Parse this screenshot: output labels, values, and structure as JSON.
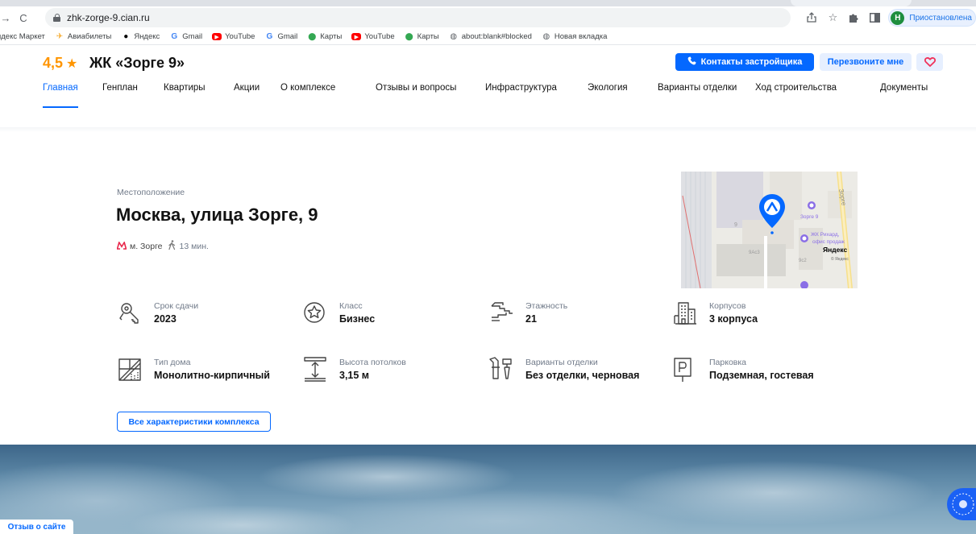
{
  "browser": {
    "url": "zhk-zorge-9.cian.ru",
    "profile_label": "Приостановлена",
    "profile_initial": "Н",
    "bookmarks": [
      {
        "label": "ндекс Маркет",
        "icon": ""
      },
      {
        "label": "Авиабилеты",
        "icon": "aviasales-icon",
        "color": "#f5a623"
      },
      {
        "label": "Яндекс",
        "icon": "yandex-icon",
        "color": "#000000"
      },
      {
        "label": "Gmail",
        "icon": "google-icon",
        "color": "#4285f4"
      },
      {
        "label": "YouTube",
        "icon": "youtube-icon",
        "color": "#ff0000"
      },
      {
        "label": "Gmail",
        "icon": "google-icon",
        "color": "#4285f4"
      },
      {
        "label": "Карты",
        "icon": "maps-pin-icon",
        "color": "#34a853"
      },
      {
        "label": "YouTube",
        "icon": "youtube-icon",
        "color": "#ff0000"
      },
      {
        "label": "Карты",
        "icon": "maps-pin-icon",
        "color": "#34a853"
      },
      {
        "label": "about:blank#blocked",
        "icon": "globe-icon",
        "color": "#5f6368"
      },
      {
        "label": "Новая вкладка",
        "icon": "globe-icon",
        "color": "#5f6368"
      }
    ]
  },
  "header": {
    "rating": "4,5",
    "title": "ЖК «Зорге 9»",
    "contacts_button": "Контакты застройщика",
    "callback_button": "Перезвоните мне",
    "nav": [
      {
        "label": "Главная",
        "active": true
      },
      {
        "label": "Генплан"
      },
      {
        "label": "Квартиры"
      },
      {
        "label": "Акции"
      },
      {
        "label": "О комплексе"
      },
      {
        "label": "Отзывы и вопросы"
      },
      {
        "label": "Инфраструктура"
      },
      {
        "label": "Экология"
      },
      {
        "label": "Варианты отделки"
      },
      {
        "label": "Ход строительства"
      },
      {
        "label": "Документы"
      }
    ]
  },
  "location": {
    "label": "Местоположение",
    "address": "Москва, улица Зорге, 9",
    "metro": "м. Зорге",
    "walk_time": "13 мин."
  },
  "map": {
    "street_label": "Зорге",
    "poi_1": "Зорге 9",
    "poi_2": "ЖК Рихард,",
    "poi_2b": "офис продаж",
    "building_1": "9",
    "building_2": "9Ас3",
    "building_3": "9с2",
    "brand": "Яндекс",
    "copyright": "© Яндекс"
  },
  "stats": [
    {
      "label": "Срок сдачи",
      "value": "2023",
      "icon": "keys-icon"
    },
    {
      "label": "Класс",
      "value": "Бизнес",
      "icon": "star-badge-icon"
    },
    {
      "label": "Этажность",
      "value": "21",
      "icon": "stairs-icon"
    },
    {
      "label": "Корпусов",
      "value": "3 корпуса",
      "icon": "buildings-icon"
    },
    {
      "label": "Тип дома",
      "value": "Монолитно-кирпичный",
      "icon": "house-type-icon"
    },
    {
      "label": "Высота потолков",
      "value": "3,15 м",
      "icon": "ceiling-height-icon"
    },
    {
      "label": "Варианты отделки",
      "value": "Без отделки, черновая",
      "icon": "finishing-tools-icon"
    },
    {
      "label": "Парковка",
      "value": "Подземная, гостевая",
      "icon": "parking-icon"
    }
  ],
  "all_characteristics_button": "Все характеристики комплекса",
  "feedback_button": "Отзыв о сайте",
  "colors": {
    "accent": "#0468ff",
    "rating": "#ff9500",
    "metro": "#e8274b",
    "favorite": "#f0325a"
  }
}
